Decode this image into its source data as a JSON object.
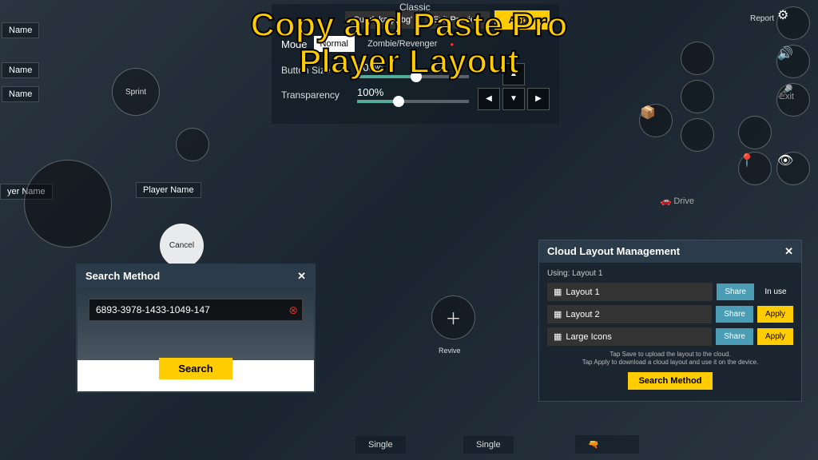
{
  "title": "Copy and Paste Pro Player Layout",
  "topbar": {
    "classic": "Classic",
    "report": "Report",
    "exit": "Exit"
  },
  "leftTags": {
    "name1": "Name",
    "name2": "Name",
    "name3": "Name",
    "playerName": "Player Name",
    "yerName": "yer Name"
  },
  "buttons": {
    "sprint": "Sprint",
    "cancel": "Cancel",
    "revive": "Revive",
    "drive": "Drive"
  },
  "settings": {
    "tab1": "Sundakarpubg'",
    "tab2": "Exit Preview",
    "apply": "Apply",
    "modeLabel": "Mode",
    "modeNormal": "Normal",
    "modeZombie": "Zombie/Revenger",
    "btnSize": {
      "label": "Button Size",
      "value": "100%",
      "pct": 52
    },
    "transparency": {
      "label": "Transparency",
      "value": "100%",
      "pct": 35
    }
  },
  "searchPopup": {
    "title": "Search Method",
    "code": "6893-3978-1433-1049-147",
    "searchBtn": "Search"
  },
  "cloudPopup": {
    "title": "Cloud Layout Management",
    "using": "Using: Layout 1",
    "rows": [
      {
        "name": "Layout 1",
        "share": "Share",
        "action": "In use",
        "inuse": true
      },
      {
        "name": "Layout 2",
        "share": "Share",
        "action": "Apply",
        "inuse": false
      },
      {
        "name": "Large Icons",
        "share": "Share",
        "action": "Apply",
        "inuse": false
      }
    ],
    "note1": "Tap Save to upload the layout to the cloud.",
    "note2": "Tap Apply to download a cloud layout and use it on the device.",
    "searchMethod": "Search Method"
  },
  "bottom": {
    "single1": "Single",
    "single2": "Single"
  }
}
